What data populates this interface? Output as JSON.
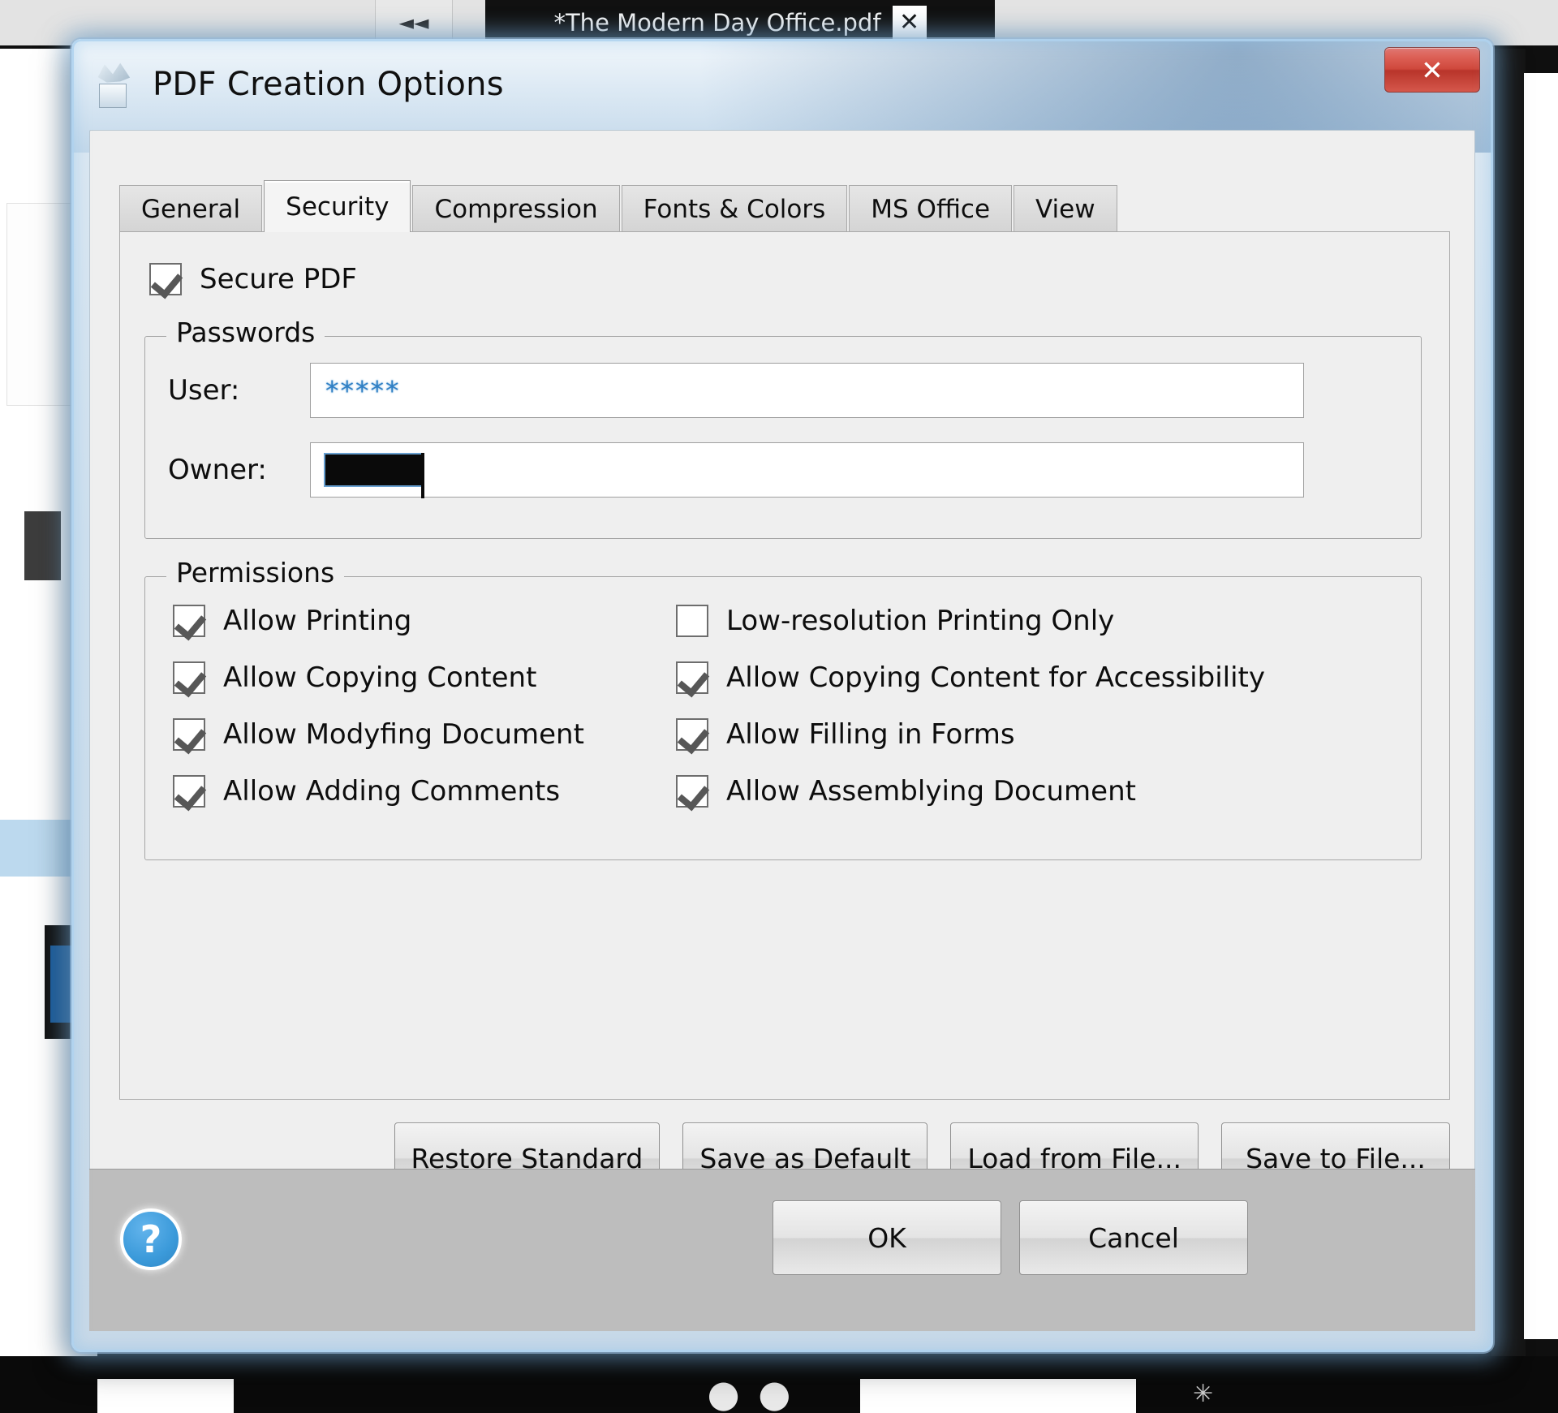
{
  "background": {
    "document_tab": {
      "title": "*The Modern Day Office.pdf",
      "close_label": "✕"
    },
    "toolbar_button_glyph": "◄◄",
    "bottom_glyph": "● ●",
    "bottom_snow_glyph": "✳"
  },
  "dialog": {
    "title": "PDF Creation Options",
    "icon": "pdf-app-icon",
    "close_label": "✕"
  },
  "tabs": [
    {
      "label": "General",
      "active": false
    },
    {
      "label": "Security",
      "active": true
    },
    {
      "label": "Compression",
      "active": false
    },
    {
      "label": "Fonts & Colors",
      "active": false
    },
    {
      "label": "MS Office",
      "active": false
    },
    {
      "label": "View",
      "active": false
    }
  ],
  "security": {
    "secure_pdf": {
      "label": "Secure PDF",
      "checked": true
    },
    "passwords": {
      "group_label": "Passwords",
      "user": {
        "label": "User:",
        "value": "*****",
        "masked": true
      },
      "owner": {
        "label": "Owner:",
        "value": "",
        "masked": true,
        "redacted": true
      }
    },
    "permissions": {
      "group_label": "Permissions",
      "items": [
        {
          "label": "Allow Printing",
          "checked": true,
          "column": "left"
        },
        {
          "label": "Low-resolution Printing Only",
          "checked": false,
          "column": "right"
        },
        {
          "label": "Allow Copying Content",
          "checked": true,
          "column": "left"
        },
        {
          "label": "Allow Copying Content for Accessibility",
          "checked": true,
          "column": "right"
        },
        {
          "label": "Allow Modyfing Document",
          "checked": true,
          "column": "left"
        },
        {
          "label": "Allow Filling in Forms",
          "checked": true,
          "column": "right"
        },
        {
          "label": "Allow Adding Comments",
          "checked": true,
          "column": "left"
        },
        {
          "label": "Allow Assemblying Document",
          "checked": true,
          "column": "right"
        }
      ]
    }
  },
  "footer_buttons": [
    {
      "label": "Restore Standard"
    },
    {
      "label": "Save as Default"
    },
    {
      "label": "Load from File..."
    },
    {
      "label": "Save to File..."
    }
  ],
  "commandbar": {
    "help_label": "?",
    "ok_label": "OK",
    "cancel_label": "Cancel"
  },
  "colors": {
    "accent_blue": "#3b9ada",
    "close_red": "#cf483c",
    "dialog_chrome": "#cfe0ee",
    "client_bg": "#efefef",
    "commandbar_bg": "#bdbdbd",
    "password_text": "#2f7fc4"
  }
}
